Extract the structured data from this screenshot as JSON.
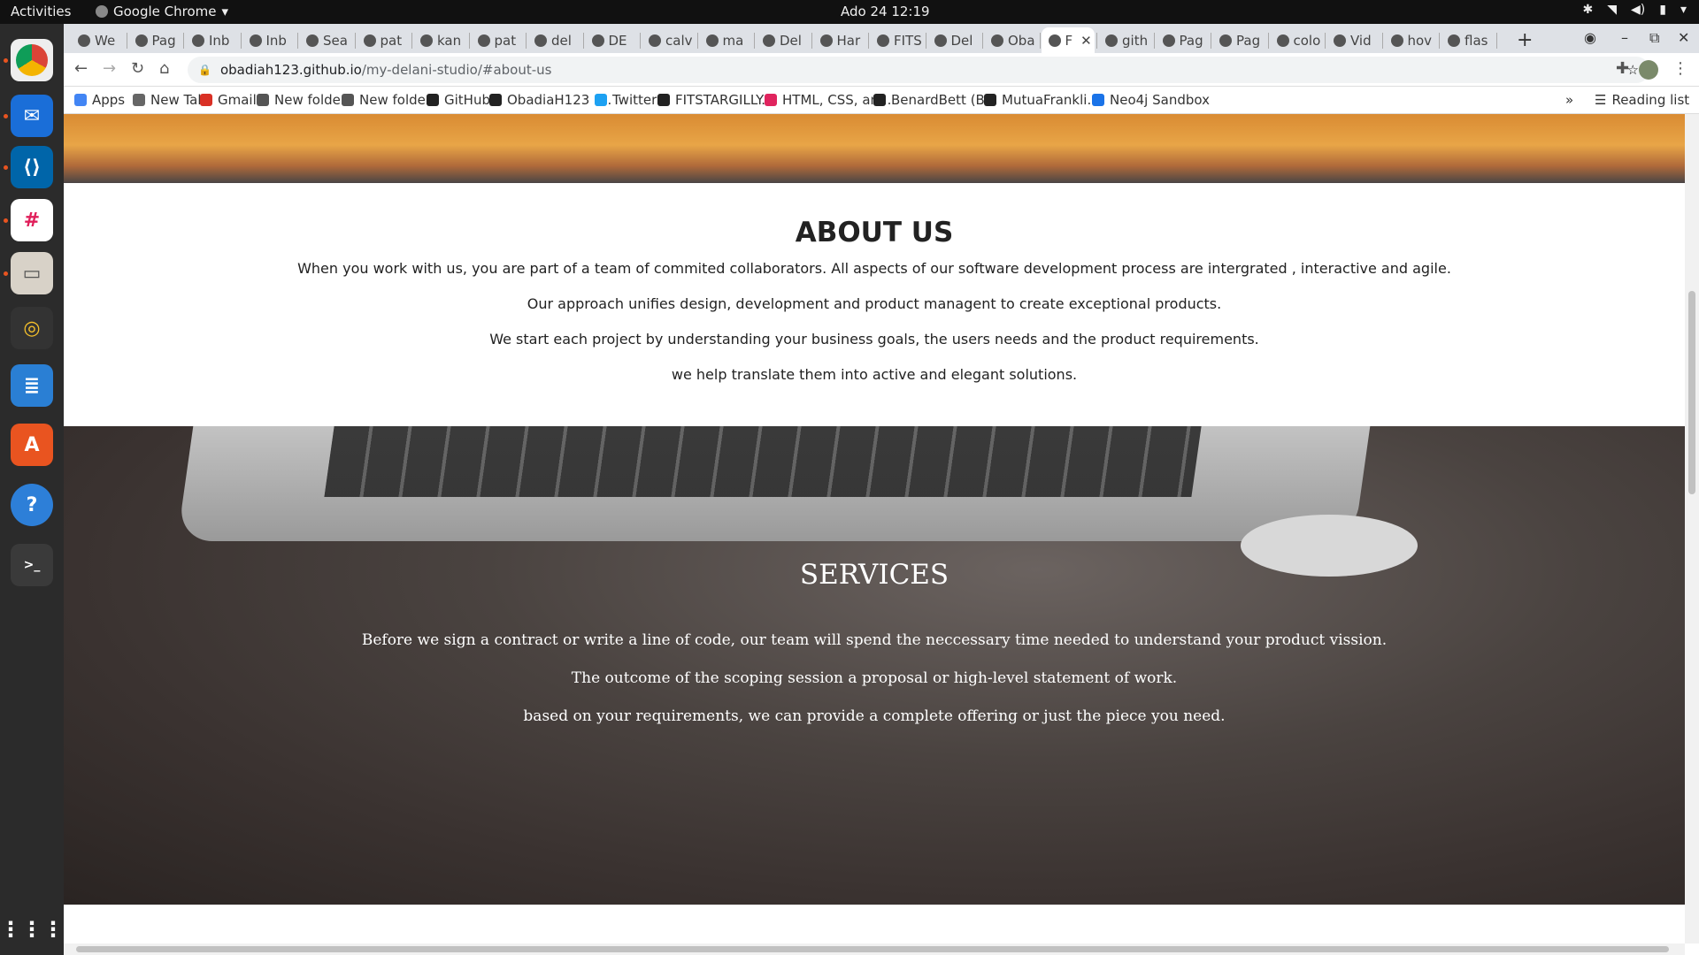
{
  "os": {
    "activities": "Activities",
    "app_name": "Google Chrome",
    "clock": "Ado 24  12:19"
  },
  "dock": {
    "items": [
      "chrome",
      "thunderbird",
      "vscode",
      "slack",
      "files",
      "rhythmbox",
      "writer",
      "software",
      "help",
      "terminal"
    ]
  },
  "browser": {
    "tabs": [
      "We",
      "Pag",
      "Inb",
      "Inb",
      "Sea",
      "pat",
      "kan",
      "pat",
      "del",
      "DE",
      "calv",
      "ma",
      "Del",
      "Har",
      "FITS",
      "Del",
      "Oba",
      "F",
      "gith",
      "Pag",
      "Pag",
      "colo",
      "Vid",
      "hov",
      "flas"
    ],
    "active_tab_index": 17,
    "url_host": "obadiah123.github.io",
    "url_path": "/my-delani-studio/#about-us",
    "bookmarks": [
      "Apps",
      "New Tab",
      "Gmail",
      "New folder",
      "New folder",
      "GitHub",
      "ObadiaH123 (...",
      "Twitter",
      "FITSTARGILLY...",
      "HTML, CSS, an...",
      "BenardBett (B...",
      "MutuaFrankli...",
      "Neo4j Sandbox"
    ],
    "overflow_label": "»",
    "reading_list": "Reading list"
  },
  "page": {
    "about": {
      "heading": "ABOUT US",
      "paragraphs": [
        "When you work with us, you are part of a team of commited collaborators. All aspects of our software development process are intergrated , interactive and agile.",
        "Our approach unifies design, development and product managent to create exceptional products.",
        "We start each project by understanding your business goals, the users needs and the product requirements.",
        "we help translate them into active and elegant solutions."
      ]
    },
    "services": {
      "heading": "SERVICES",
      "paragraphs": [
        "Before we sign a contract or write a line of code, our team will spend the neccessary time needed to understand your product vission.",
        "The outcome of the scoping session a proposal or high-level statement of work.",
        "based on your requirements, we can provide a complete offering or just the piece you need."
      ]
    }
  }
}
